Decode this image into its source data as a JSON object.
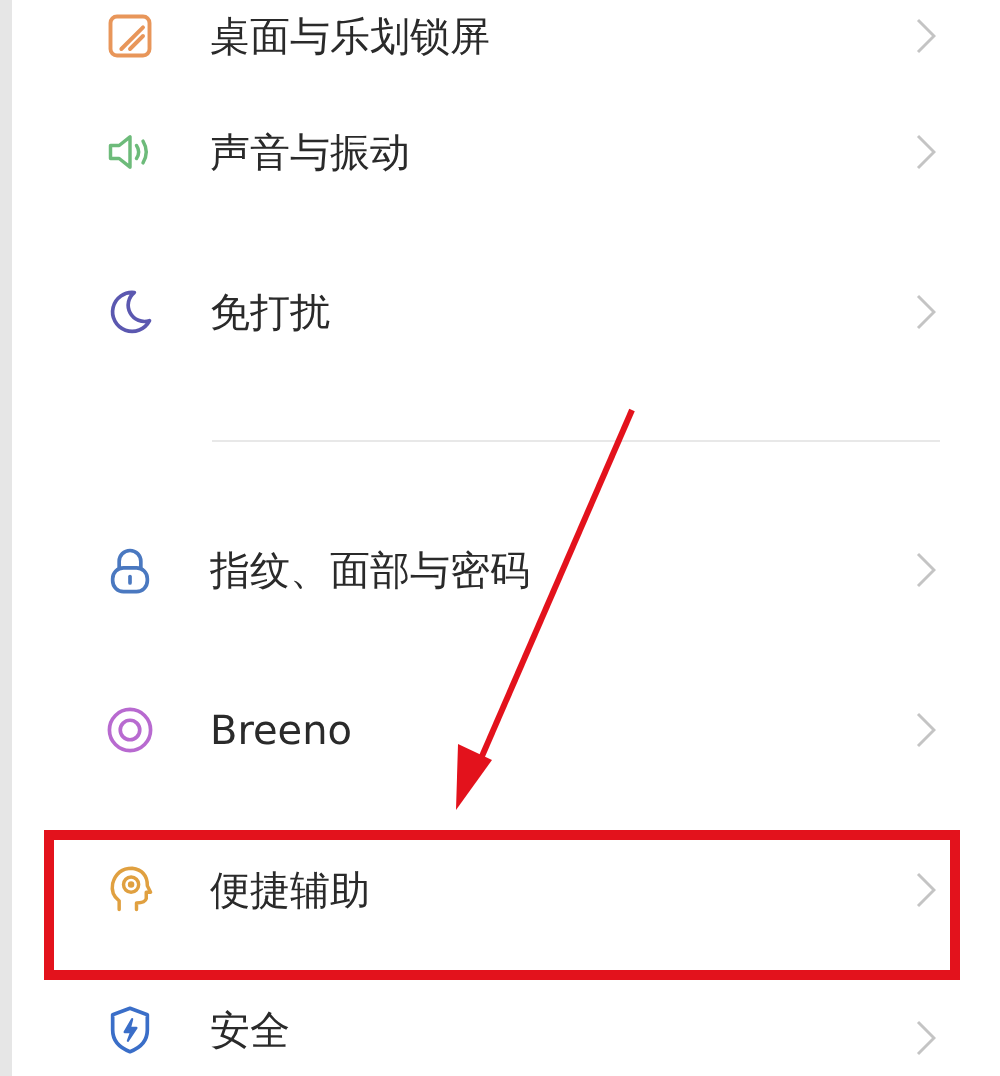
{
  "settings_items": [
    {
      "label": "桌面与乐划锁屏",
      "kind": "wallpaper",
      "color": "#e8965a",
      "highlighted": false
    },
    {
      "label": "声音与振动",
      "kind": "speaker",
      "color": "#6dbb7a",
      "highlighted": false
    },
    {
      "label": "免打扰",
      "kind": "moon",
      "color": "#5b58b0",
      "highlighted": false
    },
    {
      "label": "指纹、面部与密码",
      "kind": "lock",
      "color": "#4a78c0",
      "highlighted": false
    },
    {
      "label": "Breeno",
      "kind": "ring",
      "color": "#b86ad0",
      "highlighted": false
    },
    {
      "label": "便捷辅助",
      "kind": "head",
      "color": "#e0a040",
      "highlighted": true
    },
    {
      "label": "安全",
      "kind": "shield",
      "color": "#3a6ec8",
      "highlighted": false
    }
  ]
}
